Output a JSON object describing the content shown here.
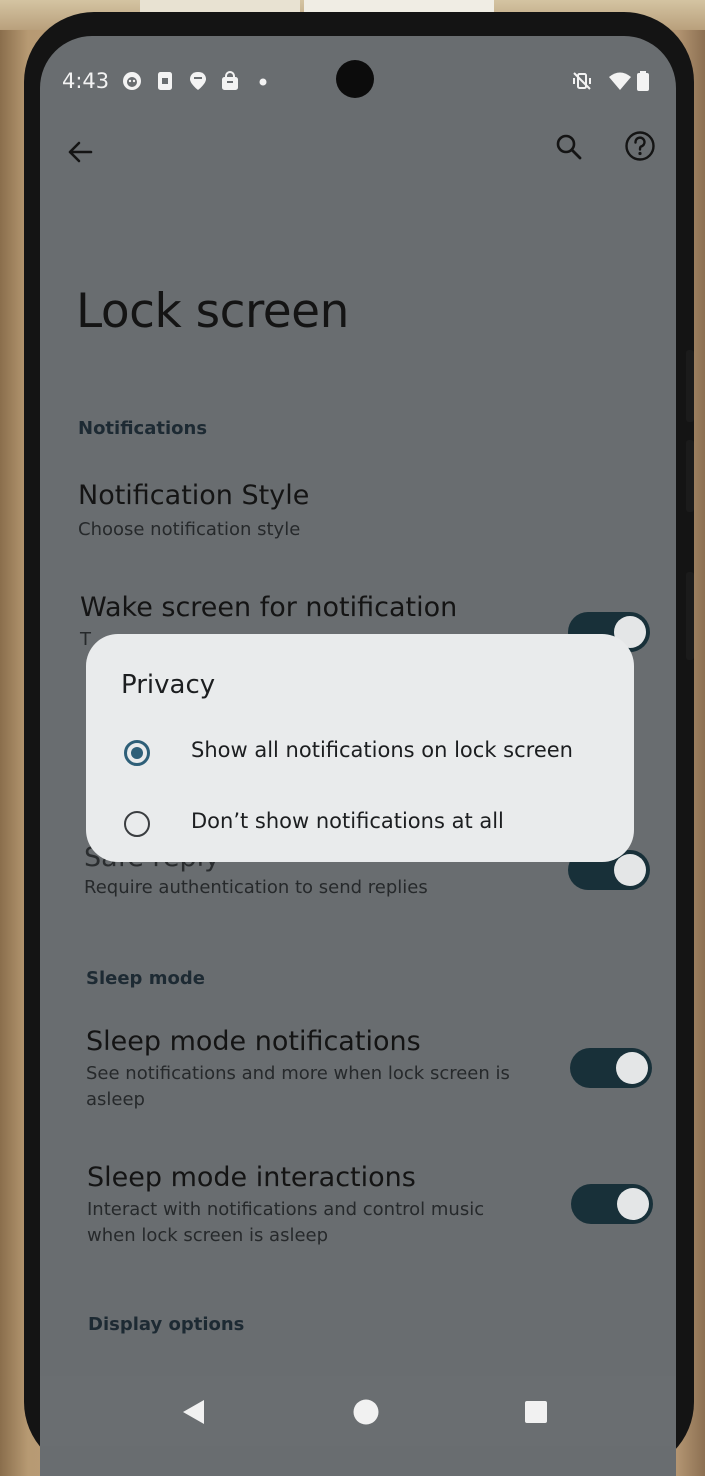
{
  "status_bar": {
    "time": "4:43",
    "left_icons": [
      "face-notification-icon",
      "sim-card-icon",
      "location-pin-icon",
      "shopping-bag-icon",
      "dot-icon"
    ],
    "right_icons": [
      "vibrate-off-icon",
      "wifi-icon",
      "battery-icon"
    ]
  },
  "toolbar": {
    "back_icon": "arrow-left-icon",
    "search_icon": "search-icon",
    "help_icon": "help-circle-icon"
  },
  "page": {
    "title": "Lock screen"
  },
  "sections": {
    "notifications_header": "Notifications",
    "notification_style": {
      "title": "Notification Style",
      "subtitle": "Choose notification style"
    },
    "wake_screen": {
      "title": "Wake screen for notification",
      "subtitle_visible": "T",
      "toggle_on": true
    },
    "safe_reply": {
      "title_visible": "Safe reply",
      "subtitle": "Require authentication to send replies",
      "toggle_on": true
    },
    "sleep_mode_header": "Sleep mode",
    "sleep_notifications": {
      "title": "Sleep mode notifications",
      "subtitle": "See notifications and more when lock screen is asleep",
      "toggle_on": true
    },
    "sleep_interactions": {
      "title": "Sleep mode interactions",
      "subtitle": "Interact with notifications and control music when lock screen is asleep",
      "toggle_on": true
    },
    "display_options_header": "Display options"
  },
  "dialog": {
    "title": "Privacy",
    "options": [
      {
        "label": "Show all notifications on lock screen",
        "selected": true
      },
      {
        "label": "Don’t show notifications at all",
        "selected": false
      }
    ]
  },
  "nav_bar": {
    "back": "nav-back-icon",
    "home": "nav-home-icon",
    "recents": "nav-recents-icon"
  },
  "colors": {
    "scrim_background": "#696d70",
    "dialog_background": "#e9ebec",
    "toggle_track": "#183039",
    "radio_accent": "#2e5f78"
  }
}
